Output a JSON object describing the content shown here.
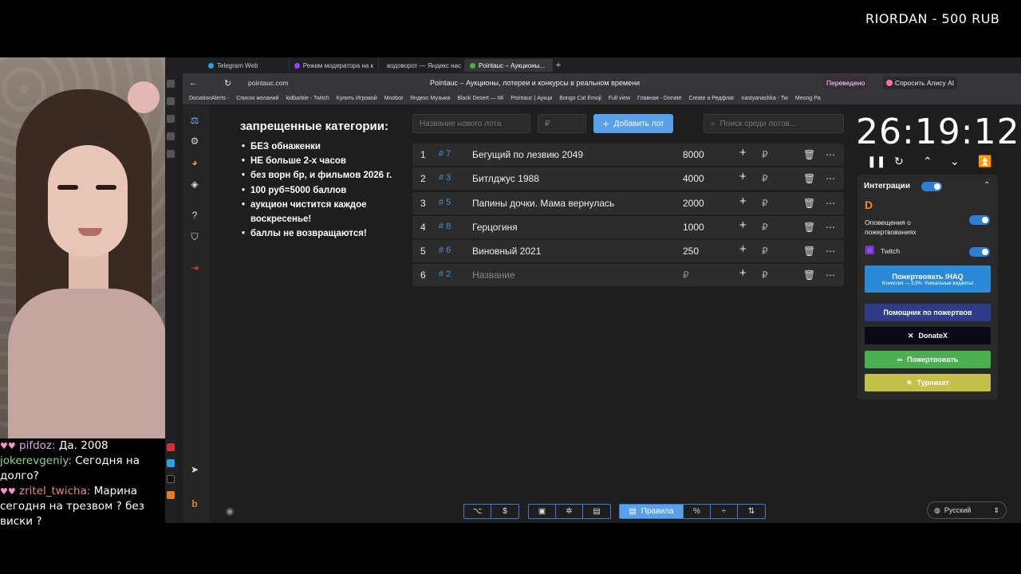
{
  "overlay": {
    "top_banner": "RIORDAN - 500 RUB"
  },
  "chat": [
    {
      "user": "pifdoz:",
      "text": "Да. 2008"
    },
    {
      "user": "jokerevgeniy:",
      "text": "Сегодня на долго?"
    },
    {
      "user": "zritel_twicha:",
      "text": "Марина сегодня на трезвом ? без виски ?"
    }
  ],
  "browser": {
    "tabs": [
      {
        "label": "Telegram Web",
        "color": "#2aa3e0",
        "active": false
      },
      {
        "label": "Режим модератора на к",
        "color": "#9146ff",
        "active": false
      },
      {
        "label": "водоворот — Яндекс нас",
        "color": "#e53935",
        "active": false
      },
      {
        "label": "Pointauc – Аукционы...",
        "color": "#4caf50",
        "active": true
      }
    ],
    "url": "pointauc.com",
    "page_title": "Pointauc – Аукционы, лотереи и конкурсы в реальном времени",
    "translated_label": "Переведено",
    "alice_label": "Спросить Алису AI",
    "bookmarks": [
      "DonationAlerts -",
      "Список желаний",
      "kidbarbie - Twitch",
      "Купить Игровой",
      "Moobot",
      "Яндекс Музыка",
      "Black Desert — Mi",
      "Pointauc | Аукци",
      "Bongo Cat Emoji",
      "Full view",
      "Главная - Donate",
      "Create a Редфлаг",
      "nastyanashka - Tw",
      "Meong Pa"
    ]
  },
  "rules": {
    "title": "запрещенные категории:",
    "items": [
      "БЕЗ обнаженки",
      "НЕ больше 2-х часов",
      "без ворн бр, и фильмов 2026 г.",
      "100 руб=5000 баллов",
      "аукцион чистится каждое воскресенье!",
      "баллы не возвращаются!"
    ]
  },
  "controls": {
    "new_lot_placeholder": "Название нового лота",
    "amount_placeholder": "₽",
    "add_button": "Добавить лот",
    "search_placeholder": "Поиск среди лотов..."
  },
  "lots": [
    {
      "num": "1",
      "id": "# 7",
      "name": "Бегущий по лезвию 2049",
      "amount": "8000"
    },
    {
      "num": "2",
      "id": "# 3",
      "name": "Битлджус 1988",
      "amount": "4000"
    },
    {
      "num": "3",
      "id": "# 5",
      "name": "Папины дочки. Мама вернулась",
      "amount": "2000"
    },
    {
      "num": "4",
      "id": "# 8",
      "name": "Герцогиня",
      "amount": "1000"
    },
    {
      "num": "5",
      "id": "# 6",
      "name": "Виновный 2021",
      "amount": "250"
    },
    {
      "num": "6",
      "id": "# 2",
      "name": "Название",
      "amount": "₽"
    }
  ],
  "lot_currency": "₽",
  "timer": "26:19:12",
  "integrations": {
    "title": "Интеграции",
    "donation_alerts_label": "Оповещения о пожертвованиях",
    "twitch_label": "Twitch",
    "buttons": {
      "donate_ihaq": "Пожертвовать IHAQ",
      "donate_ihaq_sub": "Комиссия — 3,5%. Уникальные виджеты!",
      "helper": "Помощник по пожертвов",
      "donatex": "DonateX",
      "donate": "Пожертвовать",
      "turniket": "Турникет"
    },
    "colors": {
      "ihaq": "#2a8ad9",
      "helper": "#2f3c8a",
      "donatex": "#0a0a18",
      "donate": "#4caf50",
      "turniket": "#c4c14a"
    }
  },
  "bottom_bar": {
    "rules_label": "Правила",
    "language": "Русский"
  }
}
